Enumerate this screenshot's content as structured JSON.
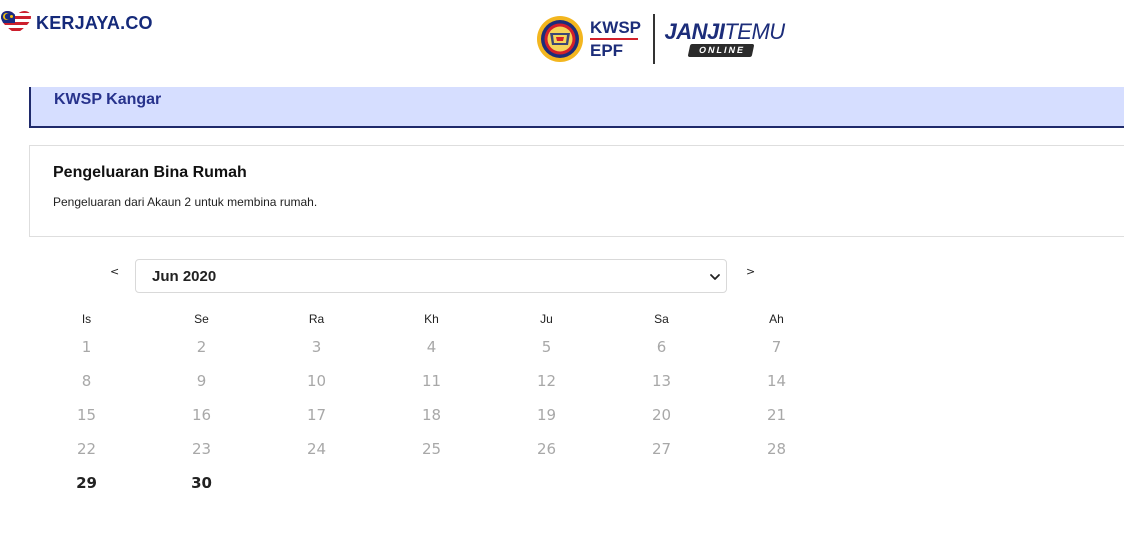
{
  "brand": {
    "watermark": "KERJAYA.CO"
  },
  "header": {
    "kwsp_line1": "KWSP",
    "kwsp_line2": "EPF",
    "janji_bold": "JANJI",
    "janji_light": "TEMU",
    "online": "ONLINE"
  },
  "branch": {
    "name": "KWSP Kangar"
  },
  "service": {
    "title": "Pengeluaran Bina Rumah",
    "description": "Pengeluaran dari Akaun 2 untuk membina rumah."
  },
  "nav": {
    "prev": "<",
    "next": ">",
    "month_selected": "Jun 2020"
  },
  "calendar": {
    "weekdays": [
      "Is",
      "Se",
      "Ra",
      "Kh",
      "Ju",
      "Sa",
      "Ah"
    ],
    "weeks": [
      [
        "1",
        "2",
        "3",
        "4",
        "5",
        "6",
        "7"
      ],
      [
        "8",
        "9",
        "10",
        "11",
        "12",
        "13",
        "14"
      ],
      [
        "15",
        "16",
        "17",
        "18",
        "19",
        "20",
        "21"
      ],
      [
        "22",
        "23",
        "24",
        "25",
        "26",
        "27",
        "28"
      ],
      [
        "29",
        "30",
        "",
        "",
        "",
        "",
        ""
      ]
    ],
    "available_days": [
      "29",
      "30"
    ]
  },
  "colors": {
    "banner_bg": "#d6deff",
    "banner_border": "#1f2a6b",
    "brand_blue": "#1c2d7a",
    "kwsp_red": "#d3202a",
    "disabled_day": "#a8a8a8"
  }
}
